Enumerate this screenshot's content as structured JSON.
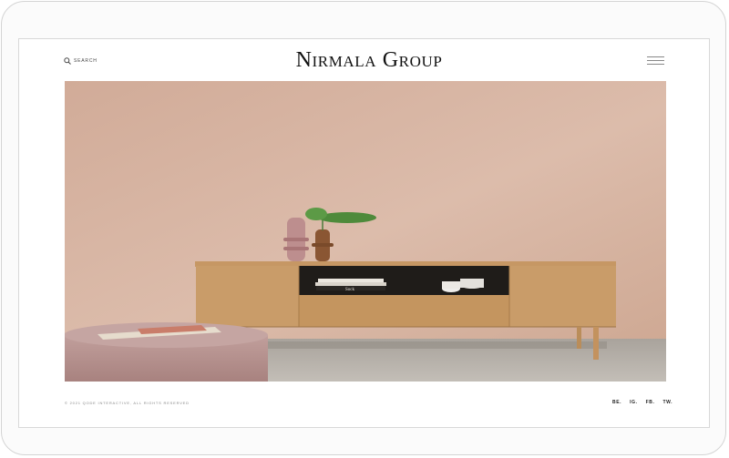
{
  "header": {
    "search_label": "SEARCH",
    "brand": "Nirmala Group"
  },
  "hero": {
    "book_spine": "Sock"
  },
  "footer": {
    "copyright": "© 2021 QODE INTERACTIVE, ALL RIGHTS RESERVED",
    "social": [
      "BE.",
      "IG.",
      "FB.",
      "TW."
    ]
  },
  "colors": {
    "wall": "#d9b8a6",
    "floor": "#b9b3ac",
    "oak": "#c89b68",
    "pouf": "#b89592"
  }
}
